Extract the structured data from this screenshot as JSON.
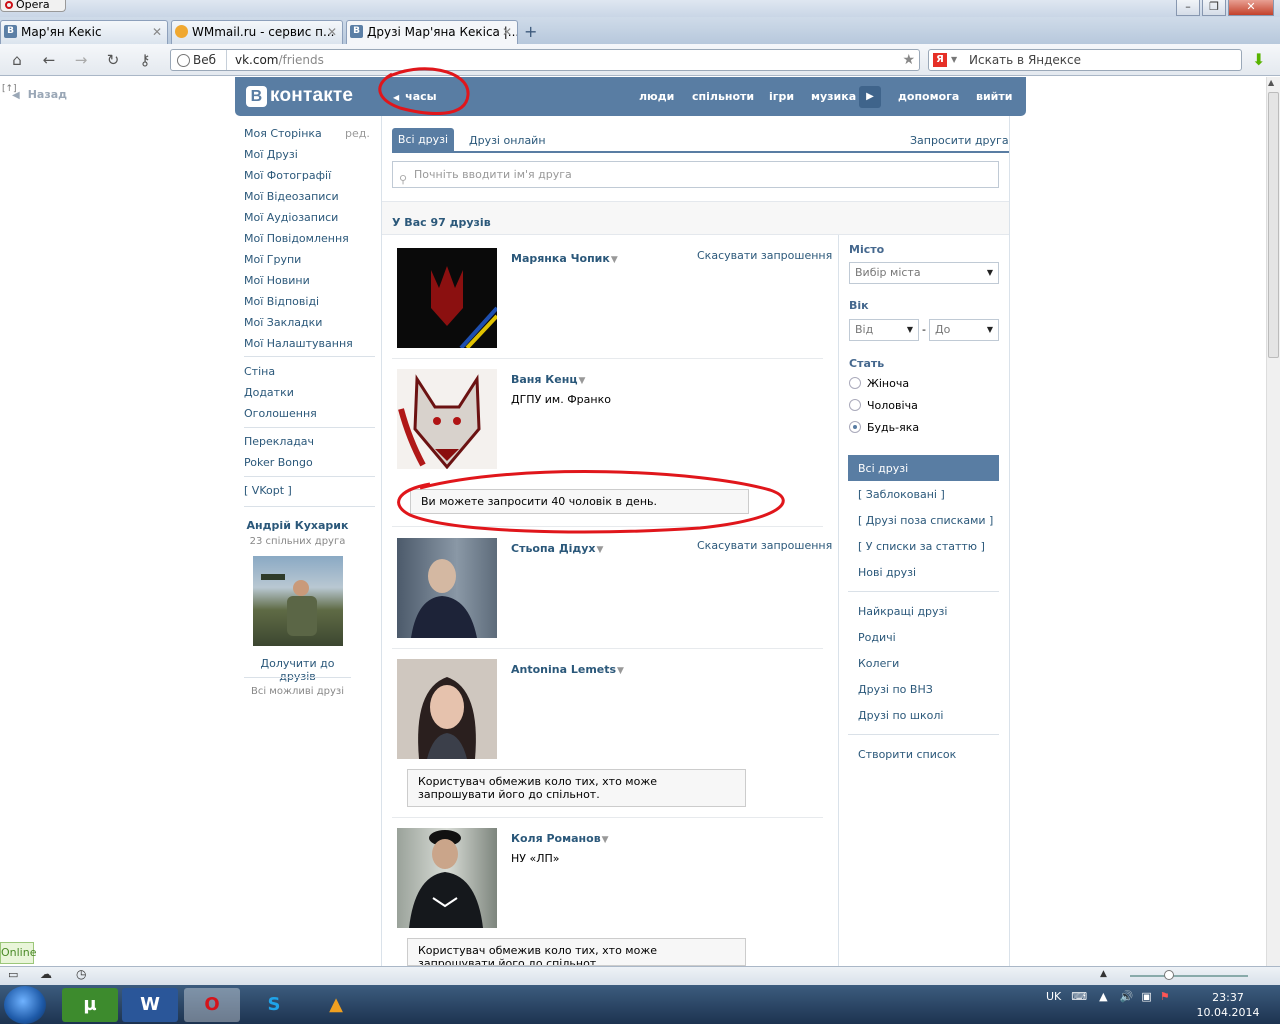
{
  "browser": {
    "app_name": "Opera",
    "tabs": [
      {
        "label": "Мар'ян Кекіс",
        "favicon": "В"
      },
      {
        "label": "WMmail.ru - сервис п...",
        "favicon": ""
      },
      {
        "label": "Друзі Мар'яна Кекіса |...",
        "favicon": "В"
      }
    ],
    "address_web_label": "Веб",
    "url_host": "vk.com",
    "url_path": "/friends",
    "search_placeholder": "Искать в Яндексе",
    "search_engine_badge": "Я"
  },
  "page": {
    "back_label": "Назад",
    "back_counter": "[↑]",
    "header": {
      "logo_letter": "В",
      "logo_text": "контакте",
      "clock_label": "часы",
      "nav": [
        "люди",
        "спільноти",
        "ігри",
        "музика",
        "допомога",
        "вийти"
      ]
    },
    "left_menu": {
      "edit_label": "ред.",
      "group1": [
        "Моя Сторінка",
        "Мої Друзі",
        "Мої Фотографії",
        "Мої Відеозаписи",
        "Мої Аудіозаписи",
        "Мої Повідомлення",
        "Мої Групи",
        "Мої Новини",
        "Мої Відповіді",
        "Мої Закладки",
        "Мої Налаштування"
      ],
      "group2": [
        "Стіна",
        "Додатки",
        "Оголошення"
      ],
      "group3": [
        "Перекладач",
        "Poker Bongo"
      ],
      "group4": [
        "[ VKopt ]"
      ],
      "suggest": {
        "name": "Андрій Кухарик",
        "mutual": "23 спільних друга",
        "add_label": "Долучити до друзів",
        "all_label": "Всі можливі друзі"
      }
    },
    "friends": {
      "tab_all": "Всі друзі",
      "tab_online": "Друзі онлайн",
      "invite_label": "Запросити друга",
      "search_placeholder": "Почніть вводити ім'я друга",
      "count_text": "У Вас 97 друзів",
      "cancel_label": "Скасувати запрошення",
      "notice_invite_limit": "Ви можете запросити 40 чоловік в день.",
      "notice_restricted": "Користувач обмежив коло тих, хто може запрошувати його до спільнот.",
      "items": [
        {
          "name": "Марянка Чопик",
          "sub": ""
        },
        {
          "name": "Ваня Кенц",
          "sub": "ДГПУ им. Франко"
        },
        {
          "name": "Стьопа Дідух",
          "sub": ""
        },
        {
          "name": "Antonina Lemets",
          "sub": ""
        },
        {
          "name": "Коля Романов",
          "sub": "НУ «ЛП»"
        }
      ]
    },
    "filters": {
      "city_label": "Місто",
      "city_value": "Вибір міста",
      "age_label": "Вік",
      "age_from": "Від",
      "age_to": "До",
      "age_dash": "-",
      "sex_label": "Стать",
      "sex_options": [
        "Жіноча",
        "Чоловіча",
        "Будь-яка"
      ],
      "sex_selected": "Будь-яка",
      "lists1": [
        "Всі друзі",
        "[ Заблоковані ]",
        "[ Друзі поза списками ]",
        "[ У списки за статтю ]",
        "Нові друзі"
      ],
      "lists2": [
        "Найкращі друзі",
        "Родичі",
        "Колеги",
        "Друзі по ВНЗ",
        "Друзі по школі"
      ],
      "create_list": "Створити список"
    }
  },
  "status": {
    "online_label": "Online"
  },
  "taskbar": {
    "lang": "UK",
    "time": "23:37",
    "date": "10.04.2014"
  },
  "colors": {
    "vk_blue": "#597da3",
    "link": "#2b587a",
    "annotation_red": "#e0161b"
  }
}
